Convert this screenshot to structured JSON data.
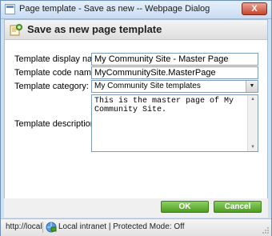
{
  "window": {
    "title": "Page template - Save as new -- Webpage Dialog",
    "close_glyph": "X"
  },
  "header": {
    "title": "Save as new page template",
    "icon": "template-add-icon"
  },
  "form": {
    "display_name": {
      "label": "Template display name:",
      "value": "My Community Site - Master Page"
    },
    "code_name": {
      "label": "Template code name:",
      "value": "MyCommunitySite.MasterPage"
    },
    "category": {
      "label": "Template category:",
      "value": "My Community Site templates"
    },
    "description": {
      "label": "Template description:",
      "value": "This is the master page of My Community Site."
    }
  },
  "buttons": {
    "ok": "OK",
    "cancel": "Cancel"
  },
  "statusbar": {
    "url": "http://localhost",
    "zone": "Local intranet | Protected Mode: Off",
    "zone_icon": "local-intranet-icon"
  }
}
